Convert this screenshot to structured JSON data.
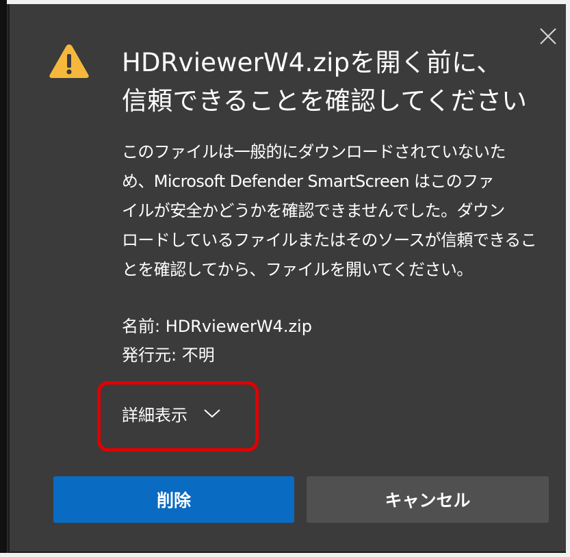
{
  "dialog": {
    "title_line1": "HDRviewerW4.zipを開く前に、",
    "title_line2": "信頼できることを確認してください",
    "description_lines": [
      "このファイルは一般的にダウンロードされていないた",
      "め、Microsoft Defender SmartScreen はこのファ",
      "イルが安全かどうかを確認できませんでした。ダウン",
      "ロードしているファイルまたはそのソースが信頼できるこ",
      "とを確認してから、ファイルを開いてください。"
    ],
    "file_name": "名前: HDRviewerW4.zip",
    "publisher": "発行元: 不明",
    "details_label": "詳細表示",
    "delete_label": "削除",
    "cancel_label": "キャンセル"
  },
  "icons": {
    "warning": "warning-icon",
    "close": "close-icon",
    "chevron": "chevron-down-icon"
  },
  "colors": {
    "dialog_background": "#3b3b3b",
    "primary_button": "#0a6bc2",
    "secondary_button": "#505050",
    "warning": "#f5b83d",
    "highlight": "#e00000",
    "text": "#ffffff"
  }
}
